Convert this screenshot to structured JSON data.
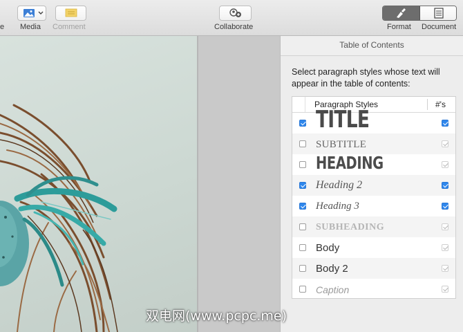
{
  "toolbar": {
    "left_partial_label": "e",
    "media_label": "Media",
    "comment_label": "Comment",
    "collaborate_label": "Collaborate",
    "format_label": "Format",
    "document_label": "Document",
    "comment_color": "#f1c232"
  },
  "inspector": {
    "title": "Table of Contents",
    "description": "Select paragraph styles whose text will appear in the table of contents:",
    "column_styles": "Paragraph Styles",
    "column_numbers": "#'s",
    "rows": [
      {
        "name": "TITLE",
        "included": true,
        "show_numbers": true
      },
      {
        "name": "SUBTITLE",
        "included": false,
        "show_numbers": true
      },
      {
        "name": "HEADING",
        "included": false,
        "show_numbers": true
      },
      {
        "name": "Heading 2",
        "included": true,
        "show_numbers": true
      },
      {
        "name": "Heading 3",
        "included": true,
        "show_numbers": true
      },
      {
        "name": "SUBHEADING",
        "included": false,
        "show_numbers": true
      },
      {
        "name": "Body",
        "included": false,
        "show_numbers": true
      },
      {
        "name": "Body 2",
        "included": false,
        "show_numbers": true
      },
      {
        "name": "Caption",
        "included": false,
        "show_numbers": true
      }
    ]
  },
  "watermark": "双电网(www.pcpc.me)"
}
